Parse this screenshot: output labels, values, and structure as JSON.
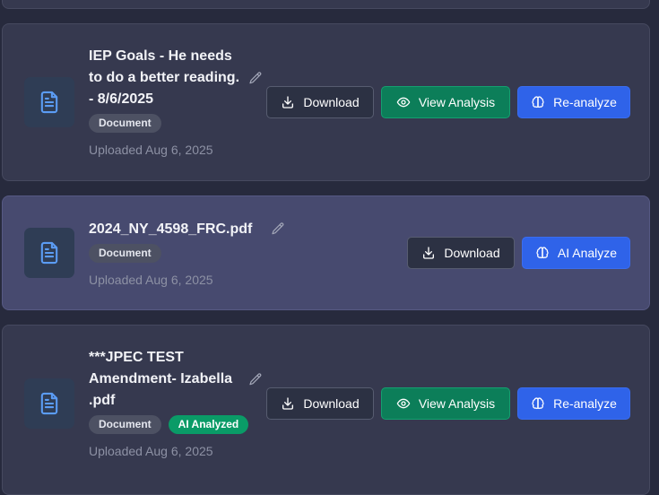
{
  "files": [
    {
      "title": "IEP Goals - He needs to do a better reading. - 8/6/2025",
      "badge_document": "Document",
      "uploaded": "Uploaded Aug 6, 2025",
      "download_label": "Download",
      "view_analysis_label": "View Analysis",
      "analyze_label": "Re-analyze"
    },
    {
      "title": "2024_NY_4598_FRC.pdf",
      "badge_document": "Document",
      "uploaded": "Uploaded Aug 6, 2025",
      "download_label": "Download",
      "analyze_label": "AI Analyze"
    },
    {
      "title": "***JPEC TEST Amendment- Izabella .pdf",
      "badge_document": "Document",
      "badge_analyzed": "AI Analyzed",
      "uploaded": "Uploaded Aug 6, 2025",
      "download_label": "Download",
      "view_analysis_label": "View Analysis",
      "analyze_label": "Re-analyze"
    }
  ],
  "colors": {
    "card_bg": "#36394f",
    "card_highlight_bg": "#474a6f",
    "download_bg": "#2c3143",
    "view_analysis_bg": "#0c7e59",
    "analyze_bg": "#2f63e9",
    "analyzed_badge_bg": "#0a9b67"
  },
  "icons": {
    "file": "file-text-icon",
    "edit": "pencil-icon",
    "download": "download-icon",
    "view": "eye-icon",
    "analyze": "brain-icon"
  }
}
